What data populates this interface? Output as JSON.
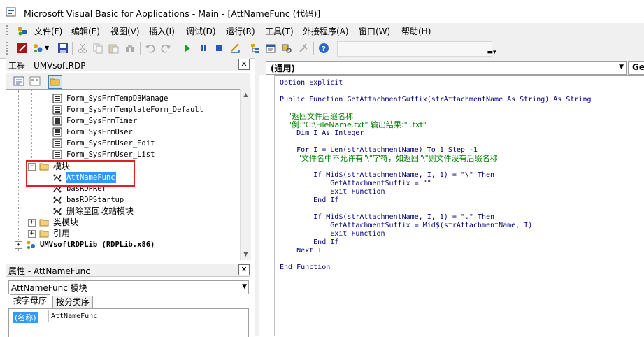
{
  "window": {
    "title": "Microsoft Visual Basic for Applications - Main - [AttNameFunc (代码)]"
  },
  "menu": [
    "文件(F)",
    "编辑(E)",
    "视图(V)",
    "插入(I)",
    "调试(D)",
    "运行(R)",
    "工具(T)",
    "外接程序(A)",
    "窗口(W)",
    "帮助(H)"
  ],
  "project_panel": {
    "title": "工程 - UMVsoftRDP",
    "tree": [
      {
        "text": "Form_SysFrmTempDBManage",
        "icon": "form-icon"
      },
      {
        "text": "Form_SysFrmTemplateForm_Default",
        "icon": "form-icon"
      },
      {
        "text": "Form_SysFrmTimer",
        "icon": "form-icon"
      },
      {
        "text": "Form_SysFrmUser",
        "icon": "form-icon"
      },
      {
        "text": "Form_SysFrmUser_Edit",
        "icon": "form-icon"
      },
      {
        "text": "Form_SysFrmUser_List",
        "icon": "form-icon"
      },
      {
        "text": "模块",
        "icon": "folder-icon"
      },
      {
        "text": "AttNameFunc",
        "icon": "module-icon",
        "selected": true
      },
      {
        "text": "basRDPRef",
        "icon": "module-icon"
      },
      {
        "text": "basRDPStartup",
        "icon": "module-icon"
      },
      {
        "text": "删除至回收站模块",
        "icon": "module-icon"
      },
      {
        "text": "类模块",
        "icon": "folder-icon"
      },
      {
        "text": "引用",
        "icon": "folder-icon"
      },
      {
        "text": "UMVsoftRDPLib (RDPLib.x86)",
        "icon": "vba-project-icon"
      }
    ]
  },
  "properties_panel": {
    "title": "属性 - AttNameFunc",
    "object": "AttNameFunc 模块",
    "tabs": [
      "按字母序",
      "按分类序"
    ],
    "property": {
      "key": "(名称)",
      "value": "AttNameFunc"
    }
  },
  "code_window": {
    "object_combo": "(通用)",
    "procedure_combo": "Ge",
    "lines": [
      {
        "text": "Option Explicit",
        "style": "kw"
      },
      {
        "text": "Public Function GetAttachmentSuffix(strAttachmentName As String) As String",
        "style": "kw"
      },
      {
        "text": "    '返回文件后缀名称",
        "style": "cm"
      },
      {
        "text": "    '例:\"C:\\FileName.txt\" 输出结果:\" .txt\"",
        "style": "cm"
      },
      {
        "text": "    Dim I As Integer",
        "style": "kw"
      },
      {
        "text": "    For I = Len(strAttachmentName) To 1 Step -1",
        "style": "kw"
      },
      {
        "text": "        '文件名中不允许有\"\\\"字符，如返回\"\\\"则文件没有后缀名称",
        "style": "cm"
      },
      {
        "text": "        If Mid$(strAttachmentName, I, 1) = \"\\\" Then",
        "style": "kw"
      },
      {
        "text": "            GetAttachmentSuffix = \"\"",
        "style": "kw"
      },
      {
        "text": "            Exit Function",
        "style": "kw"
      },
      {
        "text": "        End If",
        "style": "kw"
      },
      {
        "text": "        If Mid$(strAttachmentName, I, 1) = \".\" Then",
        "style": "kw"
      },
      {
        "text": "            GetAttachmentSuffix = Mid$(strAttachmentName, I)",
        "style": "kw"
      },
      {
        "text": "            Exit Function",
        "style": "kw"
      },
      {
        "text": "        End If",
        "style": "kw"
      },
      {
        "text": "    Next I",
        "style": "kw"
      },
      {
        "text": "End Function",
        "style": "kw"
      }
    ]
  },
  "colors": {
    "keyword": "#00007f",
    "comment": "#007f00",
    "selection": "#3399ff",
    "highlight_box": "#e02020"
  }
}
